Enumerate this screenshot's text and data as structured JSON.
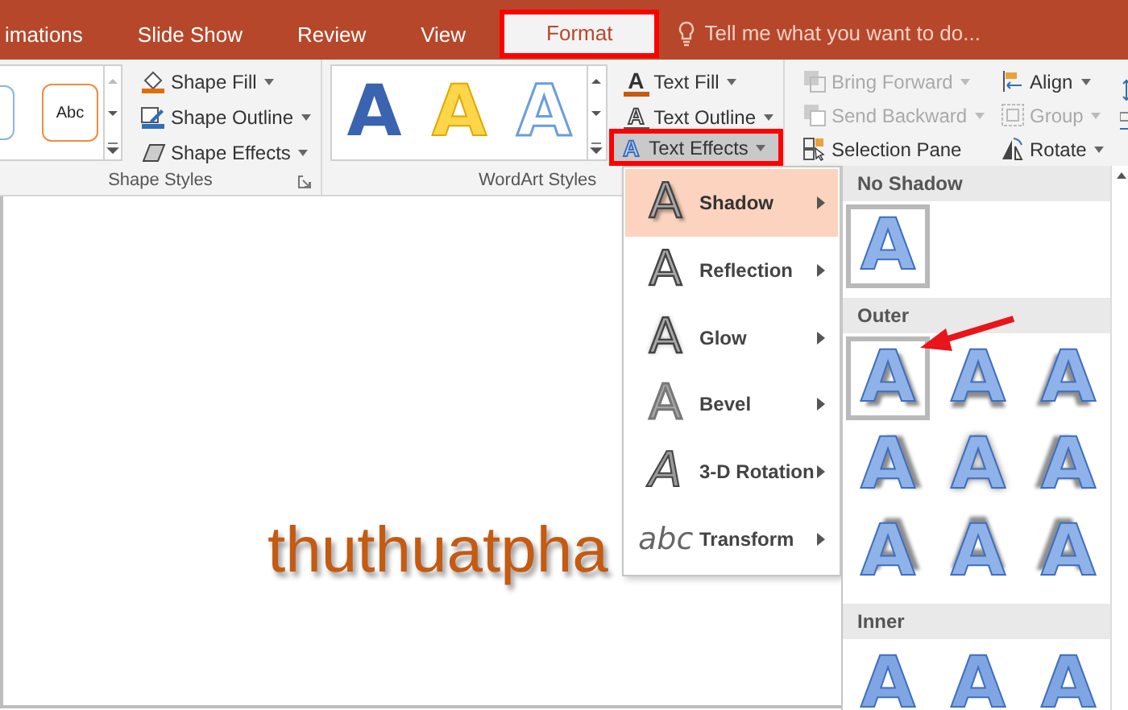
{
  "tabs": [
    {
      "label": "imations",
      "selected": false,
      "annotated": false
    },
    {
      "label": "Slide Show",
      "selected": false,
      "annotated": false
    },
    {
      "label": "Review",
      "selected": false,
      "annotated": false
    },
    {
      "label": "View",
      "selected": false,
      "annotated": false
    },
    {
      "label": "Format",
      "selected": true,
      "annotated": true
    }
  ],
  "tell_me": {
    "placeholder": "Tell me what you want to do..."
  },
  "shape_styles": {
    "label": "Shape Styles",
    "sample": "Abc",
    "buttons": [
      {
        "label": "Shape Fill",
        "kind": "shape-fill"
      },
      {
        "label": "Shape Outline",
        "kind": "shape-outline"
      },
      {
        "label": "Shape Effects",
        "kind": "shape-effects"
      }
    ]
  },
  "wordart_styles": {
    "label": "WordArt Styles",
    "samples": [
      {
        "glyph": "A",
        "kind": "blue-reflect"
      },
      {
        "glyph": "A",
        "kind": "gold"
      },
      {
        "glyph": "A",
        "kind": "outline"
      }
    ],
    "buttons": [
      {
        "label": "Text Fill",
        "kind": "text-fill",
        "icon_glyph": "A",
        "pressed": false,
        "annotated": false
      },
      {
        "label": "Text Outline",
        "kind": "text-outline",
        "icon_glyph": "A",
        "pressed": false,
        "annotated": false
      },
      {
        "label": "Text Effects",
        "kind": "text-effects",
        "icon_glyph": "A",
        "pressed": true,
        "annotated": true
      }
    ]
  },
  "arrange": {
    "columns": [
      [
        {
          "label": "Bring Forward",
          "kind": "bring-forward",
          "dropdown": true,
          "disabled": true
        },
        {
          "label": "Send Backward",
          "kind": "send-backward",
          "dropdown": true,
          "disabled": true
        },
        {
          "label": "Selection Pane",
          "kind": "selection-pane",
          "dropdown": false,
          "disabled": false
        }
      ],
      [
        {
          "label": "Align",
          "kind": "align",
          "dropdown": true,
          "disabled": false
        },
        {
          "label": "Group",
          "kind": "group",
          "dropdown": true,
          "disabled": true
        },
        {
          "label": "Rotate",
          "kind": "rotate",
          "dropdown": true,
          "disabled": false
        }
      ]
    ]
  },
  "slide": {
    "text": "thuthuatpha"
  },
  "text_effects_menu": {
    "items": [
      {
        "label": "Shadow",
        "icon_glyph": "A",
        "kind": "shadow",
        "selected": true
      },
      {
        "label": "Reflection",
        "icon_glyph": "A",
        "kind": "reflection",
        "selected": false
      },
      {
        "label": "Glow",
        "icon_glyph": "A",
        "kind": "glow",
        "selected": false
      },
      {
        "label": "Bevel",
        "icon_glyph": "A",
        "kind": "bevel",
        "selected": false
      },
      {
        "label": "3-D Rotation",
        "icon_glyph": "A",
        "kind": "rotation",
        "selected": false
      },
      {
        "label": "Transform",
        "icon_glyph": "abc",
        "kind": "transform",
        "selected": false
      }
    ]
  },
  "shadow_gallery": {
    "sections": [
      {
        "heading": "No Shadow",
        "items": [
          {
            "glyph": "A",
            "kind": "none",
            "selected": true
          }
        ]
      },
      {
        "heading": "Outer",
        "items": [
          {
            "glyph": "A",
            "kind": "bottom-right",
            "selected": true
          },
          {
            "glyph": "A",
            "kind": "bottom",
            "selected": false
          },
          {
            "glyph": "A",
            "kind": "bottom-left",
            "selected": false
          },
          {
            "glyph": "A",
            "kind": "right",
            "selected": false
          },
          {
            "glyph": "A",
            "kind": "center",
            "selected": false
          },
          {
            "glyph": "A",
            "kind": "left",
            "selected": false
          },
          {
            "glyph": "A",
            "kind": "top-right",
            "selected": false
          },
          {
            "glyph": "A",
            "kind": "top",
            "selected": false
          },
          {
            "glyph": "A",
            "kind": "top-left",
            "selected": false
          }
        ]
      },
      {
        "heading": "Inner",
        "items": [
          {
            "glyph": "A",
            "kind": "inner",
            "selected": false
          },
          {
            "glyph": "A",
            "kind": "inner",
            "selected": false
          },
          {
            "glyph": "A",
            "kind": "inner",
            "selected": false
          }
        ]
      }
    ]
  }
}
